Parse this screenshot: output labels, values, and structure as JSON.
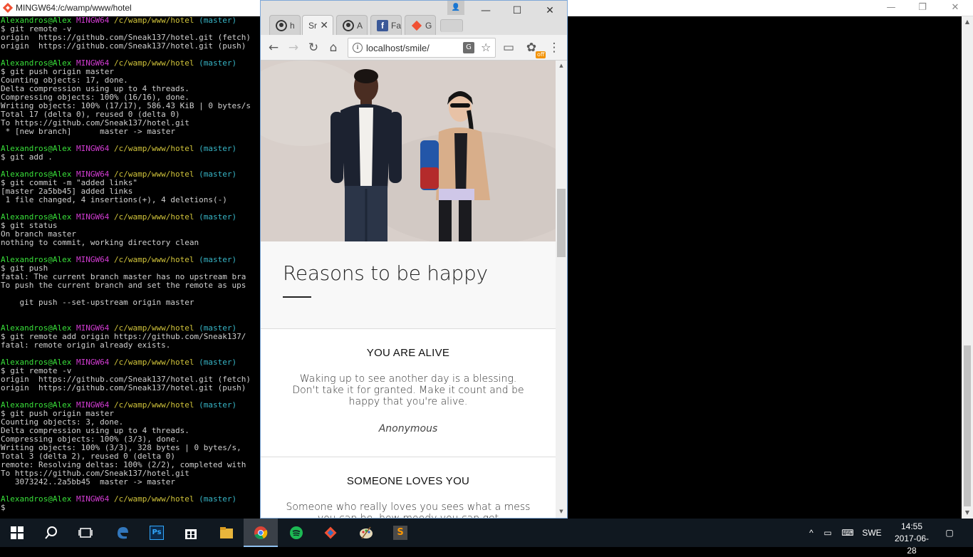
{
  "terminal": {
    "title": "MINGW64:/c/wamp/www/hotel",
    "lines": [
      {
        "p": true,
        "user": "Alexandros@Alex",
        "host": "MINGW64",
        "path": "/c/wamp/www/hotel",
        "branch": "(master)"
      },
      {
        "t": "$ git remote -v"
      },
      {
        "t": "origin  https://github.com/Sneak137/hotel.git (fetch)"
      },
      {
        "t": "origin  https://github.com/Sneak137/hotel.git (push)"
      },
      {
        "t": ""
      },
      {
        "p": true,
        "user": "Alexandros@Alex",
        "host": "MINGW64",
        "path": "/c/wamp/www/hotel",
        "branch": "(master)"
      },
      {
        "t": "$ git push origin master"
      },
      {
        "t": "Counting objects: 17, done."
      },
      {
        "t": "Delta compression using up to 4 threads."
      },
      {
        "t": "Compressing objects: 100% (16/16), done."
      },
      {
        "t": "Writing objects: 100% (17/17), 586.43 KiB | 0 bytes/s"
      },
      {
        "t": "Total 17 (delta 0), reused 0 (delta 0)"
      },
      {
        "t": "To https://github.com/Sneak137/hotel.git"
      },
      {
        "t": " * [new branch]      master -> master"
      },
      {
        "t": ""
      },
      {
        "p": true,
        "user": "Alexandros@Alex",
        "host": "MINGW64",
        "path": "/c/wamp/www/hotel",
        "branch": "(master)"
      },
      {
        "t": "$ git add ."
      },
      {
        "t": ""
      },
      {
        "p": true,
        "user": "Alexandros@Alex",
        "host": "MINGW64",
        "path": "/c/wamp/www/hotel",
        "branch": "(master)"
      },
      {
        "t": "$ git commit -m \"added links\""
      },
      {
        "t": "[master 2a5bb45] added links"
      },
      {
        "t": " 1 file changed, 4 insertions(+), 4 deletions(-)"
      },
      {
        "t": ""
      },
      {
        "p": true,
        "user": "Alexandros@Alex",
        "host": "MINGW64",
        "path": "/c/wamp/www/hotel",
        "branch": "(master)"
      },
      {
        "t": "$ git status"
      },
      {
        "t": "On branch master"
      },
      {
        "t": "nothing to commit, working directory clean"
      },
      {
        "t": ""
      },
      {
        "p": true,
        "user": "Alexandros@Alex",
        "host": "MINGW64",
        "path": "/c/wamp/www/hotel",
        "branch": "(master)"
      },
      {
        "t": "$ git push"
      },
      {
        "t": "fatal: The current branch master has no upstream bra"
      },
      {
        "t": "To push the current branch and set the remote as ups"
      },
      {
        "t": ""
      },
      {
        "t": "    git push --set-upstream origin master"
      },
      {
        "t": ""
      },
      {
        "t": ""
      },
      {
        "p": true,
        "user": "Alexandros@Alex",
        "host": "MINGW64",
        "path": "/c/wamp/www/hotel",
        "branch": "(master)"
      },
      {
        "t": "$ git remote add origin https://github.com/Sneak137/"
      },
      {
        "t": "fatal: remote origin already exists."
      },
      {
        "t": ""
      },
      {
        "p": true,
        "user": "Alexandros@Alex",
        "host": "MINGW64",
        "path": "/c/wamp/www/hotel",
        "branch": "(master)"
      },
      {
        "t": "$ git remote -v"
      },
      {
        "t": "origin  https://github.com/Sneak137/hotel.git (fetch)"
      },
      {
        "t": "origin  https://github.com/Sneak137/hotel.git (push)"
      },
      {
        "t": ""
      },
      {
        "p": true,
        "user": "Alexandros@Alex",
        "host": "MINGW64",
        "path": "/c/wamp/www/hotel",
        "branch": "(master)"
      },
      {
        "t": "$ git push origin master"
      },
      {
        "t": "Counting objects: 3, done."
      },
      {
        "t": "Delta compression using up to 4 threads."
      },
      {
        "t": "Compressing objects: 100% (3/3), done."
      },
      {
        "t": "Writing objects: 100% (3/3), 328 bytes | 0 bytes/s,"
      },
      {
        "t": "Total 3 (delta 2), reused 0 (delta 0)"
      },
      {
        "t": "remote: Resolving deltas: 100% (2/2), completed with"
      },
      {
        "t": "To https://github.com/Sneak137/hotel.git"
      },
      {
        "t": "   3073242..2a5bb45  master -> master"
      },
      {
        "t": ""
      },
      {
        "p": true,
        "user": "Alexandros@Alex",
        "host": "MINGW64",
        "path": "/c/wamp/www/hotel",
        "branch": "(master)"
      },
      {
        "t": "$ "
      }
    ]
  },
  "browser": {
    "tabs": [
      {
        "label": "h",
        "icon": "github-icon"
      },
      {
        "label": "Sr",
        "icon": "page-icon",
        "close": "✕"
      },
      {
        "label": "A",
        "icon": "github-icon"
      },
      {
        "label": "Fa",
        "icon": "facebook-icon"
      },
      {
        "label": "G",
        "icon": "git-icon"
      }
    ],
    "url": "localhost/smile/",
    "extension_badge": "off",
    "colors": {
      "accent": "#7ea8d8",
      "facebook": "#3b5998",
      "git": "#f05033"
    }
  },
  "page": {
    "heading": "Reasons to be happy",
    "reasons": [
      {
        "title": "YOU ARE ALIVE",
        "body": "Waking up to see another day is a blessing. Don't take it for granted. Make it count and be happy that you're alive.",
        "author": "Anonymous"
      },
      {
        "title": "SOMEONE LOVES YOU",
        "body": "Someone who really loves you sees what a mess you can be, how moody you can get",
        "author": ""
      }
    ]
  },
  "taskbar": {
    "apps": [
      "start-button",
      "search-button",
      "task-view-button",
      "edge-icon",
      "photoshop-icon",
      "store-icon",
      "file-explorer-icon",
      "chrome-icon",
      "spotify-icon",
      "sourcetree-icon",
      "paint-icon",
      "sublime-text-icon"
    ],
    "language": "SWE",
    "time": "14:55",
    "date": "2017-06-28"
  }
}
